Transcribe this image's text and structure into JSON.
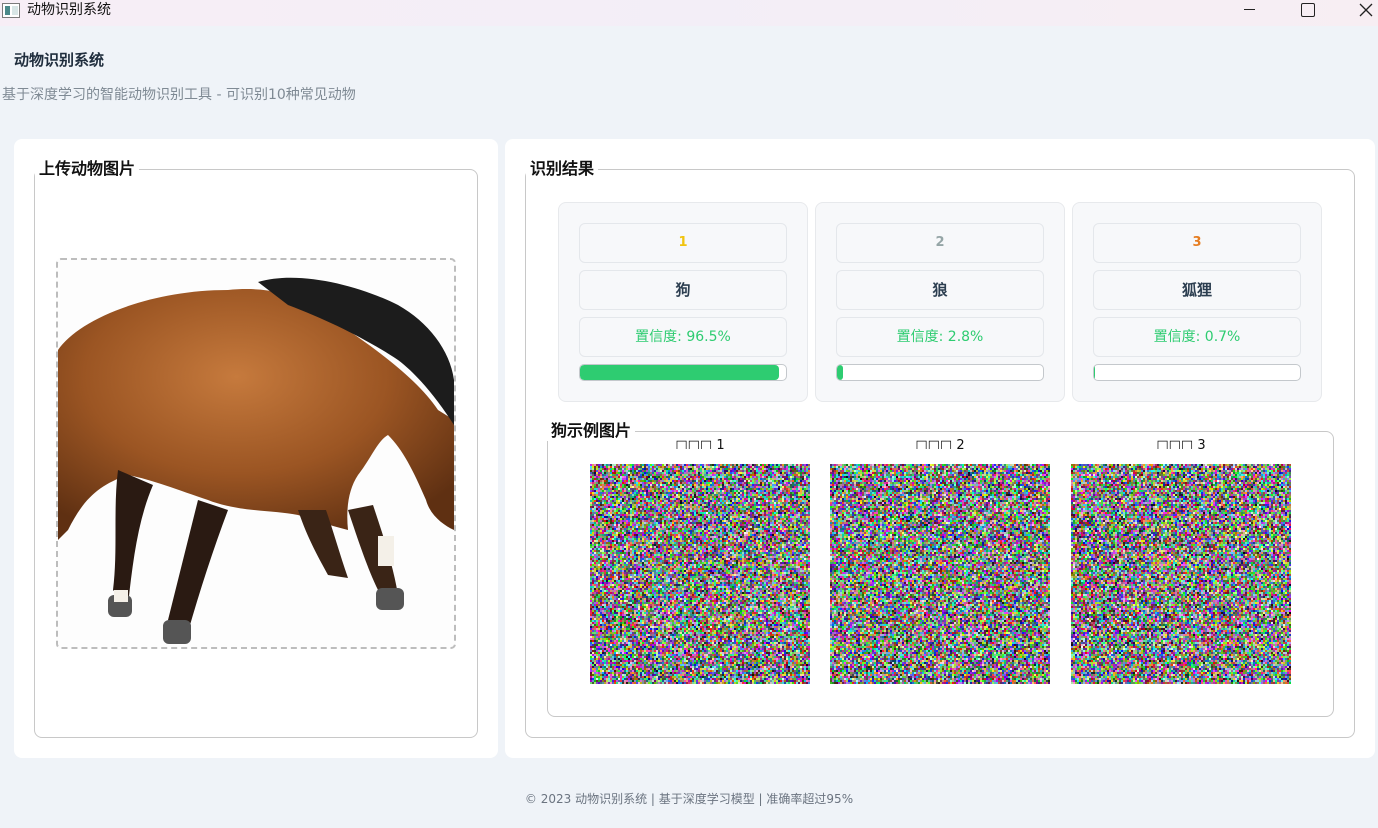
{
  "window": {
    "title": "动物识别系统",
    "controls": [
      "minimize-icon",
      "maximize-icon",
      "close-icon"
    ]
  },
  "header": {
    "title": "动物识别系统",
    "subtitle": "基于深度学习的智能动物识别工具 - 可识别10种常见动物"
  },
  "upload": {
    "group_title": "上传动物图片",
    "image_subject": "horse-photo"
  },
  "results": {
    "group_title": "识别结果",
    "cards": [
      {
        "rank": "1",
        "name": "狗",
        "confidence": "置信度: 96.5%",
        "value": 0.965,
        "rank_color": "#f1c40f"
      },
      {
        "rank": "2",
        "name": "狼",
        "confidence": "置信度: 2.8%",
        "value": 0.028,
        "rank_color": "#95a5a6"
      },
      {
        "rank": "3",
        "name": "狐狸",
        "confidence": "置信度: 0.7%",
        "value": 0.007,
        "rank_color": "#e67e22"
      }
    ],
    "bar_color": "#2ecc71"
  },
  "examples": {
    "group_title": "狗示例图片",
    "labels": [
      "□□□ 1",
      "□□□ 2",
      "□□□ 3"
    ]
  },
  "footer": {
    "text": "© 2023 动物识别系统 | 基于深度学习模型 | 准确率超过95%"
  }
}
